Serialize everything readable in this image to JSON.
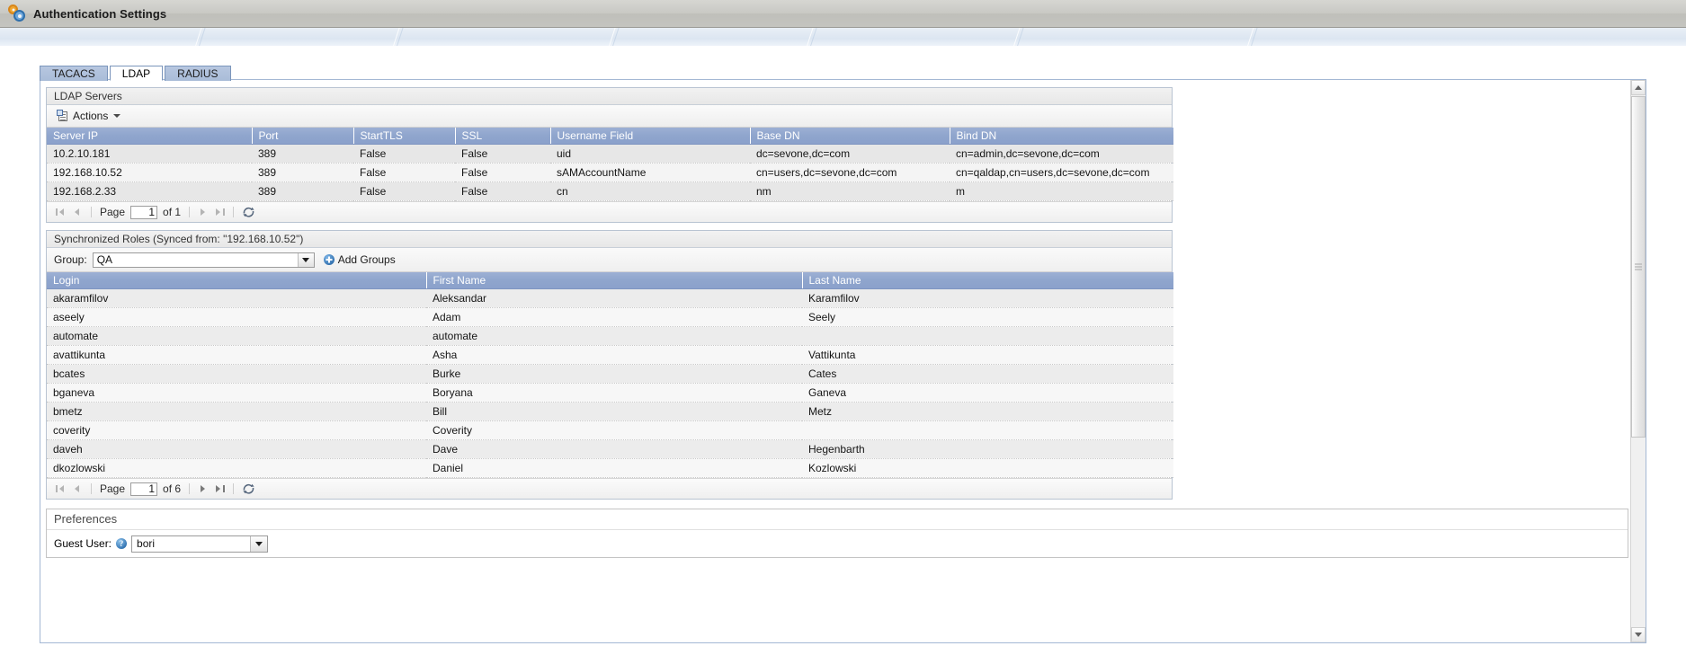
{
  "window": {
    "title": "Authentication Settings",
    "icon": "gears-icon"
  },
  "tabs": [
    {
      "label": "TACACS",
      "active": false
    },
    {
      "label": "LDAP",
      "active": true
    },
    {
      "label": "RADIUS",
      "active": false
    }
  ],
  "ldap_servers": {
    "section_title": "LDAP Servers",
    "toolbar": {
      "actions_label": "Actions"
    },
    "columns": [
      "Server IP",
      "Port",
      "StartTLS",
      "SSL",
      "Username Field",
      "Base DN",
      "Bind DN"
    ],
    "rows": [
      {
        "server_ip": "10.2.10.181",
        "port": "389",
        "start_tls": "False",
        "ssl": "False",
        "username_field": "uid",
        "base_dn": "dc=sevone,dc=com",
        "bind_dn": "cn=admin,dc=sevone,dc=com"
      },
      {
        "server_ip": "192.168.10.52",
        "port": "389",
        "start_tls": "False",
        "ssl": "False",
        "username_field": "sAMAccountName",
        "base_dn": "cn=users,dc=sevone,dc=com",
        "bind_dn": "cn=qaldap,cn=users,dc=sevone,dc=com"
      },
      {
        "server_ip": "192.168.2.33",
        "port": "389",
        "start_tls": "False",
        "ssl": "False",
        "username_field": "cn",
        "base_dn": "nm",
        "bind_dn": "m"
      }
    ],
    "pager": {
      "page_label": "Page",
      "page_value": "1",
      "of_label": "of 1"
    }
  },
  "synchronized_roles": {
    "section_title": "Synchronized Roles (Synced from: \"192.168.10.52\")",
    "group_label": "Group:",
    "group_value": "QA",
    "add_groups_label": "Add Groups",
    "columns": [
      "Login",
      "First Name",
      "Last Name"
    ],
    "rows": [
      {
        "login": "akaramfilov",
        "first_name": "Aleksandar",
        "last_name": "Karamfilov"
      },
      {
        "login": "aseely",
        "first_name": "Adam",
        "last_name": "Seely"
      },
      {
        "login": "automate",
        "first_name": "automate",
        "last_name": ""
      },
      {
        "login": "avattikunta",
        "first_name": "Asha",
        "last_name": "Vattikunta"
      },
      {
        "login": "bcates",
        "first_name": "Burke",
        "last_name": "Cates"
      },
      {
        "login": "bganeva",
        "first_name": "Boryana",
        "last_name": "Ganeva"
      },
      {
        "login": "bmetz",
        "first_name": "Bill",
        "last_name": "Metz"
      },
      {
        "login": "coverity",
        "first_name": "Coverity",
        "last_name": ""
      },
      {
        "login": "daveh",
        "first_name": "Dave",
        "last_name": "Hegenbarth"
      },
      {
        "login": "dkozlowski",
        "first_name": "Daniel",
        "last_name": "Kozlowski"
      }
    ],
    "pager": {
      "page_label": "Page",
      "page_value": "1",
      "of_label": "of 6"
    }
  },
  "preferences": {
    "section_title": "Preferences",
    "guest_user_label": "Guest User:",
    "guest_user_value": "bori"
  },
  "colors": {
    "grid_header": "#8fa5cd",
    "tab_inactive": "#aebfd9",
    "accent_blue": "#2f6fad"
  }
}
